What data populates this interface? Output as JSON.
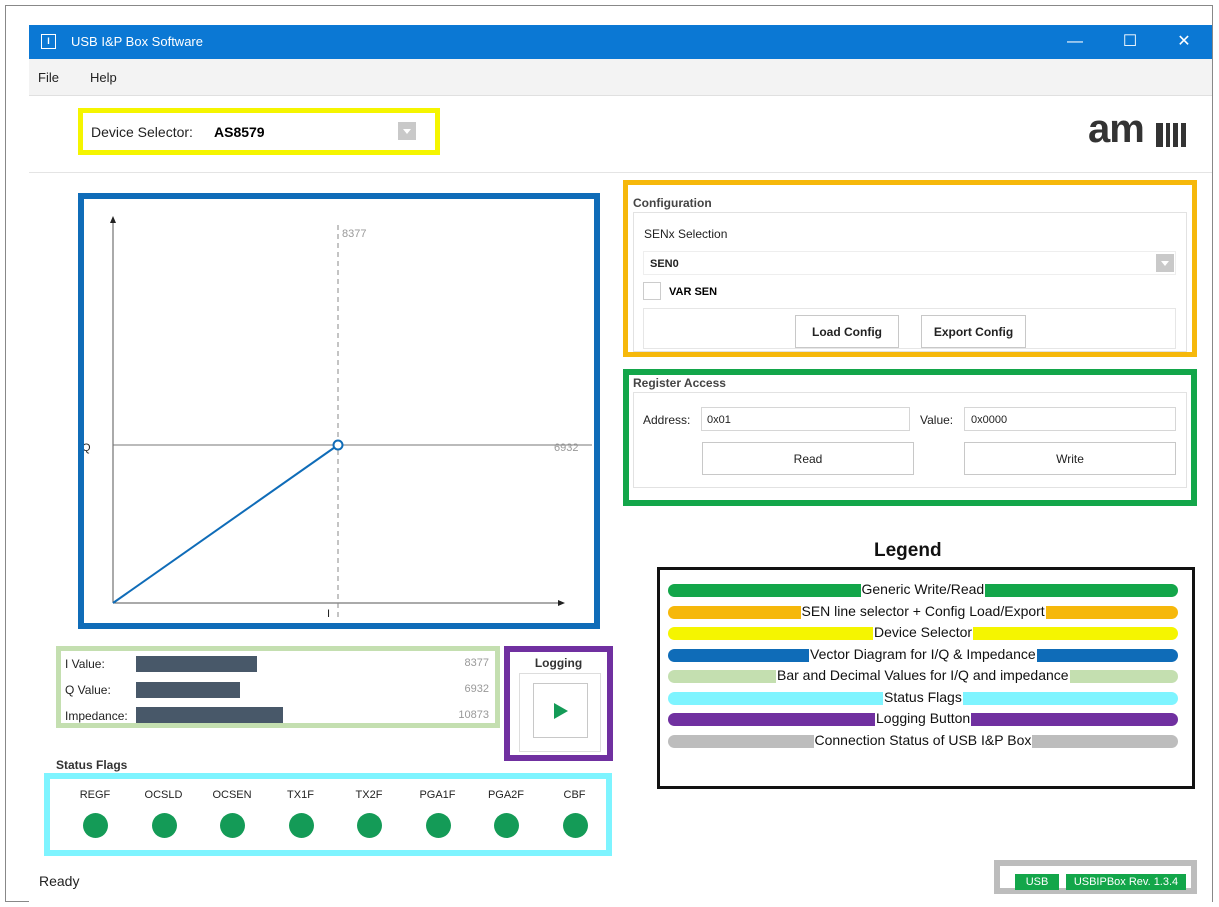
{
  "window": {
    "title": "USB I&P Box Software",
    "icon": "amsl-app-icon"
  },
  "menu": {
    "items": [
      "File",
      "Help"
    ]
  },
  "device_selector": {
    "label": "Device Selector:",
    "value": "AS8579"
  },
  "logo": "am",
  "vector_diagram": {
    "i_label": "I",
    "q_label": "Q",
    "i_marker": "8377",
    "q_marker": "6932",
    "i_value": 8377,
    "q_value": 6932
  },
  "values": {
    "rows": [
      {
        "label": "I Value:",
        "value": "8377",
        "fraction": 0.29
      },
      {
        "label": "Q Value:",
        "value": "6932",
        "fraction": 0.24
      },
      {
        "label": "Impedance:",
        "value": "10873",
        "fraction": 0.37
      }
    ]
  },
  "logging": {
    "title": "Logging",
    "icon": "play-icon"
  },
  "status_flags": {
    "title": "Status Flags",
    "flags": [
      "REGF",
      "OCSLD",
      "OCSEN",
      "TX1F",
      "TX2F",
      "PGA1F",
      "PGA2F",
      "CBF"
    ],
    "color": "#149b57"
  },
  "configuration": {
    "title": "Configuration",
    "sen_selection_label": "SENx Selection",
    "sen_value": "SEN0",
    "var_sen_label": "VAR SEN",
    "load_button": "Load Config",
    "export_button": "Export Config"
  },
  "register_access": {
    "title": "Register Access",
    "address_label": "Address:",
    "address_value": "0x01",
    "value_label": "Value:",
    "value_value": "0x0000",
    "read_button": "Read",
    "write_button": "Write"
  },
  "legend": {
    "title": "Legend",
    "entries": [
      {
        "text": "Generic Write/Read",
        "color": "#13a64a"
      },
      {
        "text": "SEN line selector + Config Load/Export",
        "color": "#f6b80b"
      },
      {
        "text": "Device Selector",
        "color": "#f5f500"
      },
      {
        "text": "Vector Diagram for I/Q & Impedance",
        "color": "#0f6cb8"
      },
      {
        "text": "Bar and Decimal Values for I/Q and impedance",
        "color": "#c4dfb0"
      },
      {
        "text": "Status Flags",
        "color": "#7ef4ff"
      },
      {
        "text": "Logging Button",
        "color": "#7030a0"
      },
      {
        "text": "Connection Status of USB I&P Box",
        "color": "#bdbdbd"
      }
    ]
  },
  "status_bar": {
    "text": "Ready",
    "usb": "USB",
    "revision": "USBIPBox Rev. 1.3.4"
  },
  "colors": {
    "titlebar": "#0b78d4",
    "yellow": "#f5f500",
    "orange": "#f6b80b",
    "green": "#13a64a",
    "blue": "#0f6cb8",
    "light_green": "#c4dfb0",
    "cyan": "#7ef4ff",
    "purple": "#7030a0",
    "gray": "#bdbdbd"
  }
}
